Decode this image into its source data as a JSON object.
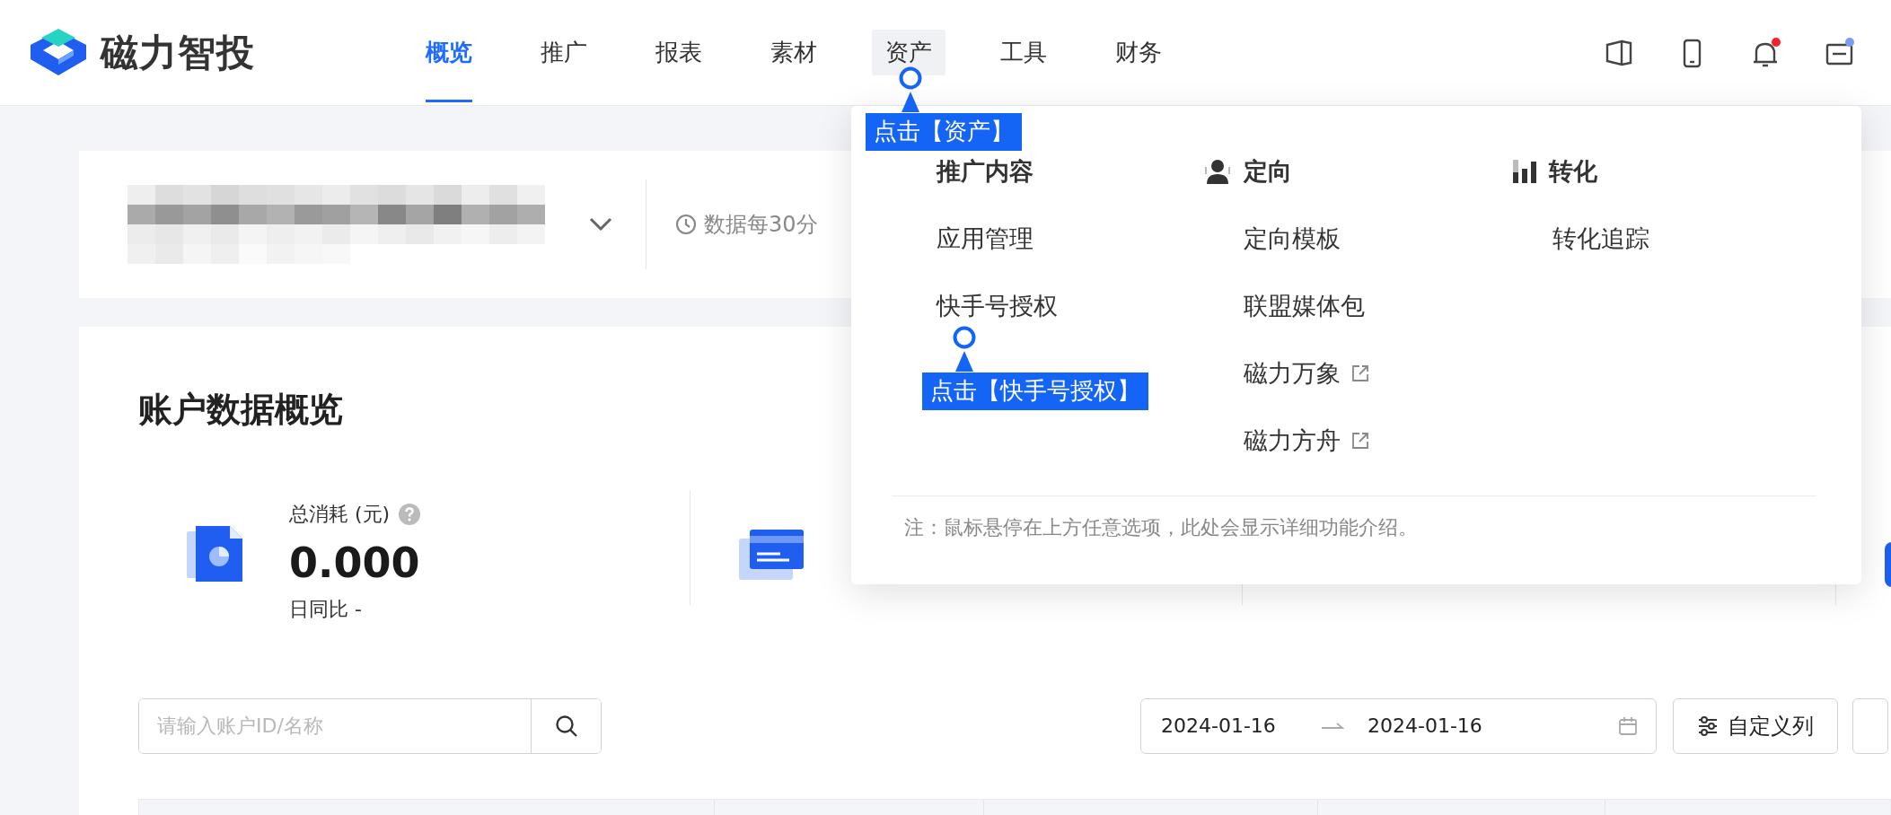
{
  "brand": {
    "name": "磁力智投"
  },
  "nav": [
    {
      "label": "概览",
      "selected": true,
      "hovered": false
    },
    {
      "label": "推广",
      "selected": false,
      "hovered": false
    },
    {
      "label": "报表",
      "selected": false,
      "hovered": false
    },
    {
      "label": "素材",
      "selected": false,
      "hovered": false
    },
    {
      "label": "资产",
      "selected": false,
      "hovered": true
    },
    {
      "label": "工具",
      "selected": false,
      "hovered": false
    },
    {
      "label": "财务",
      "selected": false,
      "hovered": false
    }
  ],
  "header_icons": [
    {
      "kind": "book",
      "badge": false
    },
    {
      "kind": "phone",
      "badge": false
    },
    {
      "kind": "bell",
      "badge": true,
      "color": "#f5222d"
    },
    {
      "kind": "message",
      "badge": true,
      "color": "#7b9cf0"
    }
  ],
  "account_bar": {
    "refresh_note": "数据每30分"
  },
  "overview": {
    "title": "账户数据概览",
    "stats": [
      {
        "kind": "document",
        "label": "总消耗 (元)",
        "help": true,
        "value": "0.000",
        "comparison": "日同比 -"
      },
      {
        "kind": "card"
      },
      {
        "kind": "plain"
      },
      {
        "kind": "partial"
      }
    ]
  },
  "toolbar": {
    "search": {
      "placeholder": "请输入账户ID/名称"
    },
    "date_range": {
      "start": "2024-01-16",
      "end": "2024-01-16"
    },
    "buttons": [
      {
        "label": "自定义列",
        "kind": "columns"
      },
      {
        "kind": "partial"
      }
    ]
  },
  "dropdown": {
    "columns": [
      {
        "title": "推广内容",
        "kind": "text",
        "items": [
          {
            "label": "应用管理",
            "external": false
          },
          {
            "label": "快手号授权",
            "external": false
          }
        ]
      },
      {
        "title": "定向",
        "kind": "person",
        "items": [
          {
            "label": "定向模板",
            "external": false
          },
          {
            "label": "联盟媒体包",
            "external": false
          },
          {
            "label": "磁力万象",
            "external": true
          },
          {
            "label": "磁力方舟",
            "external": true
          }
        ]
      },
      {
        "title": "转化",
        "kind": "bars",
        "items": [
          {
            "label": "转化追踪",
            "external": false
          }
        ]
      }
    ],
    "note": "注：鼠标悬停在上方任意选项，此处会显示详细功能介绍。"
  },
  "callouts": [
    {
      "text": "点击【资产】"
    },
    {
      "text": "点击【快手号授权】"
    }
  ]
}
